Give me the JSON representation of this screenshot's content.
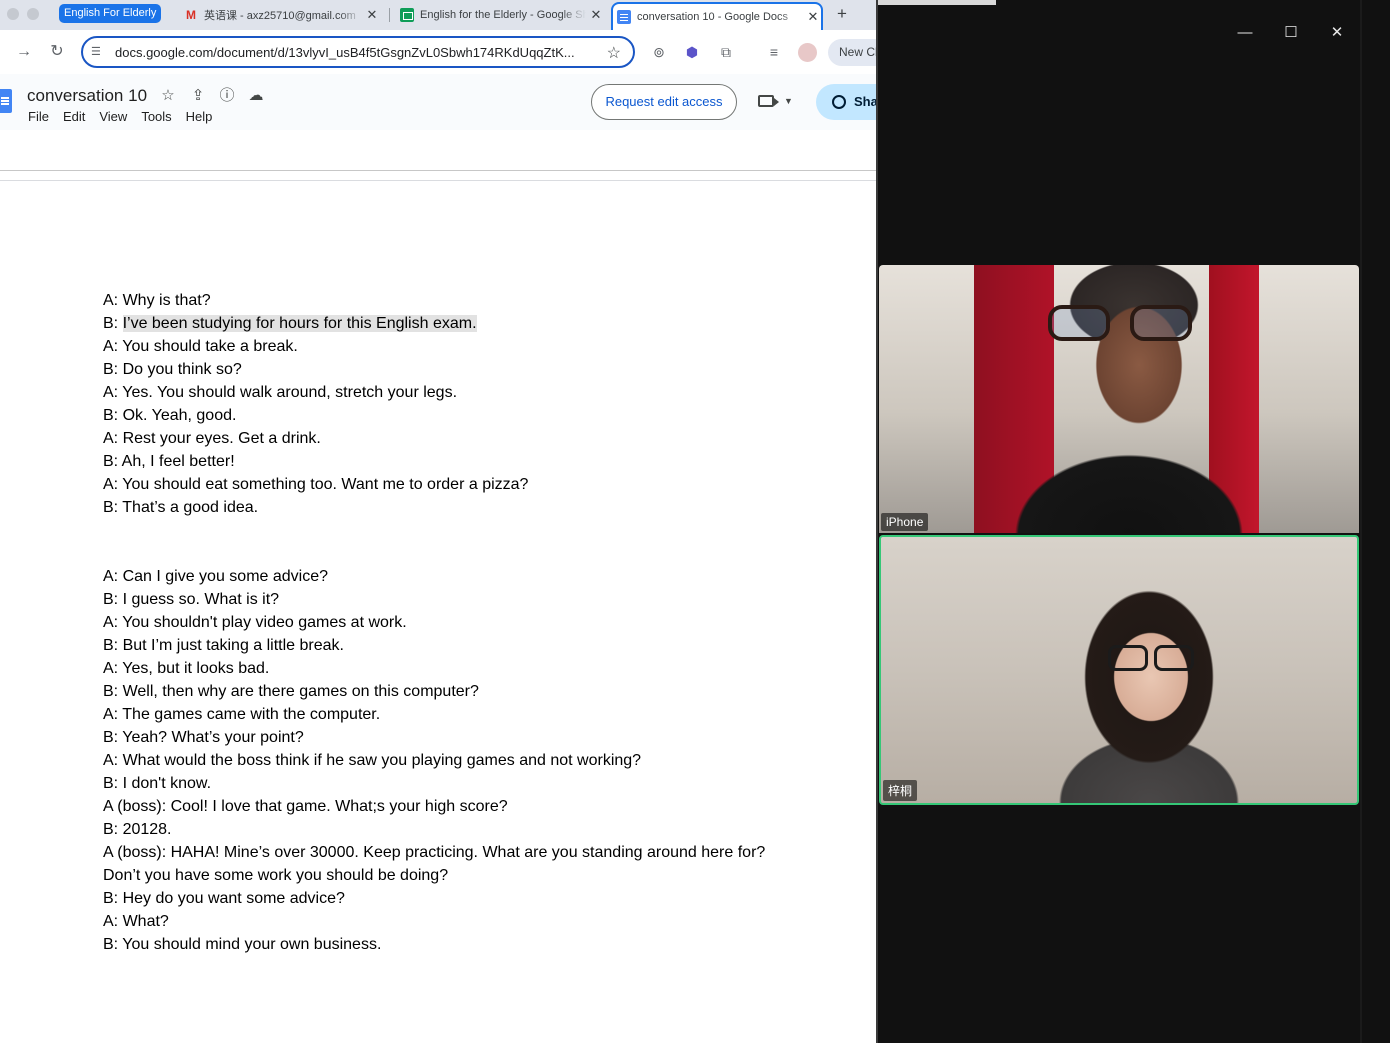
{
  "browser": {
    "tab_group": "English For Elderly",
    "tabs": [
      {
        "title": "英语课 - axz25710@gmail.com",
        "icon": "gmail-icon"
      },
      {
        "title": "English for the Elderly - Google Sheets",
        "icon": "sheets-icon"
      },
      {
        "title": "conversation 10 - Google Docs",
        "icon": "docs-icon",
        "active": true
      }
    ],
    "new_tab": "+",
    "url": "docs.google.com/document/d/13vlyvI_usB4f5tGsgnZvL0Sbwh174RKdUqqZtK...",
    "new_chrome_label": "New Chrome available"
  },
  "doc": {
    "title": "conversation 10",
    "menu": [
      "File",
      "Edit",
      "View",
      "Tools",
      "Help"
    ],
    "request_edit_label": "Request edit access",
    "share_label": "Share",
    "lines": [
      "A: Why is that?",
      "B: ",
      "A: You should take a break.",
      "B: Do you think so?",
      "A: Yes. You should walk around, stretch your legs.",
      "B: Ok. Yeah, good.",
      "A: Rest your eyes. Get a drink.",
      "B: Ah, I feel better!",
      "A: You should eat something too. Want me to order a pizza?",
      "B: That’s a good idea.",
      "A: Can I give you some advice?",
      "B: I guess so. What is it?",
      "A: You shouldn't play video games at work.",
      "B: But I’m just taking a little break.",
      "A: Yes, but it looks bad.",
      "B: Well, then why are there games on this computer?",
      "A: The games came with the computer.",
      "B: Yeah? What’s your point?",
      "A: What would the boss think if he saw you playing games and not working?",
      "B: I don't know.",
      "A (boss): Cool! I love that game. What;s your high score?",
      "B: 20128.",
      "A (boss): HAHA! Mine’s over 30000. Keep practicing. What are you standing around here for?",
      "Don’t you have some work you should be doing?",
      "B: Hey do you want some advice?",
      "A: What?",
      "B: You should mind your own business."
    ],
    "highlighted_text": "I’ve been studying for hours for this English exam."
  },
  "call": {
    "participants": [
      {
        "name": "iPhone",
        "active_speaker": false
      },
      {
        "name": "梓桐",
        "active_speaker": true
      }
    ],
    "active_speaker_color": "#35c777"
  },
  "colors": {
    "accent": "#1a73e8",
    "share_bg": "#c2e7ff",
    "call_bg": "#111111"
  }
}
